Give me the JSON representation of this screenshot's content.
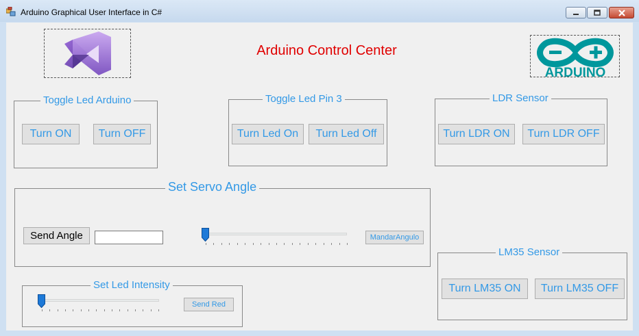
{
  "window": {
    "title": "Arduino Graphical User Interface in C#",
    "accent": "#3399e6",
    "title_color": "#e00000"
  },
  "header": {
    "title": "Arduino Control Center",
    "arduino_logo_text": "ARDUINO"
  },
  "toggle_led_arduino": {
    "label": "Toggle Led Arduino",
    "on_label": "Turn ON",
    "off_label": "Turn OFF"
  },
  "toggle_led_pin3": {
    "label": "Toggle Led Pin 3",
    "on_label": "Turn Led On",
    "off_label": "Turn Led Off"
  },
  "ldr_sensor": {
    "label": "LDR Sensor",
    "on_label": "Turn LDR ON",
    "off_label": "Turn LDR OFF"
  },
  "servo": {
    "label": "Set Servo Angle",
    "send_label": "Send Angle",
    "input_value": "",
    "mandar_label": "MandarAngulo",
    "slider_value": 0
  },
  "led_intensity": {
    "label": "Set Led Intensity",
    "send_label": "Send Red",
    "slider_value": 0
  },
  "lm35": {
    "label": "LM35 Sensor",
    "on_label": "Turn LM35 ON",
    "off_label": "Turn LM35 OFF"
  }
}
